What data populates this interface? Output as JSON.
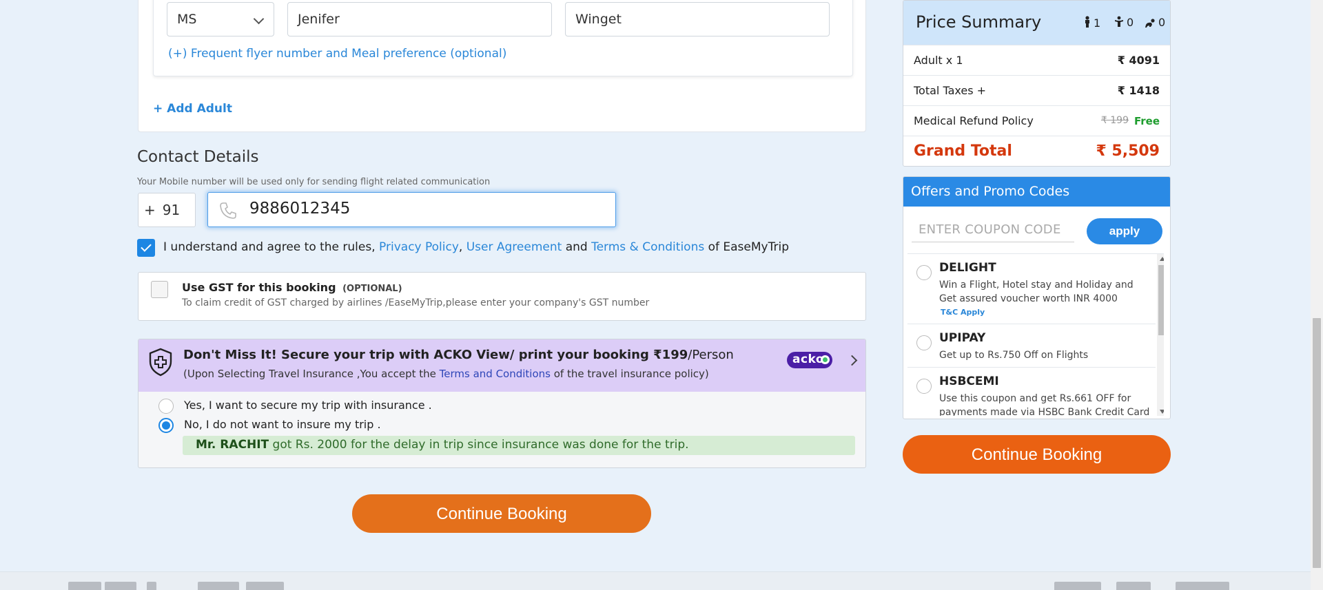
{
  "traveller": {
    "title_value": "MS",
    "first_name": "Jenifer",
    "last_name": "Winget",
    "ff_link": "(+) Frequent flyer number and Meal preference (optional)",
    "add_adult": "+ Add Adult"
  },
  "contact": {
    "title": "Contact Details",
    "subtitle": "Your Mobile number will be used only for sending flight related communication",
    "country_plus": "+",
    "country_code": "91",
    "mobile": "9886012345"
  },
  "agree": {
    "prefix": "I understand and agree to the rules,",
    "privacy": "Privacy Policy",
    "sep": ",",
    "user_agreement": "User Agreement",
    "and": "and",
    "terms": "Terms & Conditions",
    "suffix": "of EaseMyTrip"
  },
  "gst": {
    "title": "Use GST for this booking",
    "optional": "(OPTIONAL)",
    "subtitle": "To claim credit of GST charged by airlines /EaseMyTrip,please enter your company's GST number"
  },
  "insurance": {
    "title": "Don't Miss It! Secure your trip with ACKO View/ print your booking",
    "price": "₹199",
    "per": "/Person",
    "sub_prefix": "(Upon Selecting Travel Insurance ,You accept the",
    "sub_link": "Terms and Conditions",
    "sub_suffix": "of the travel insurance policy)",
    "brand": "acko",
    "option_yes": "Yes, I want to secure my trip with insurance .",
    "option_no": "No, I do not want to insure my trip .",
    "selected": "no",
    "testimonial_name": "Mr. RACHIT",
    "testimonial_text": "got Rs. 2000 for the delay in trip since insurance was done for the trip."
  },
  "continue_label": "Continue Booking",
  "price_summary": {
    "title": "Price Summary",
    "adults": "1",
    "children": "0",
    "infants": "0",
    "rows": [
      {
        "label": "Adult x 1",
        "amount": "₹ 4091"
      },
      {
        "label": "Total Taxes +",
        "amount": "₹ 1418"
      },
      {
        "label": "Medical Refund Policy",
        "strike": "₹ 199",
        "amount": "Free"
      }
    ],
    "grand_label": "Grand Total",
    "grand_amount": "₹ 5,509"
  },
  "offers": {
    "title": "Offers and Promo Codes",
    "placeholder": "ENTER COUPON CODE",
    "apply_label": "apply",
    "items": [
      {
        "code": "DELIGHT",
        "desc": "Win a Flight, Hotel stay and Holiday and Get assured voucher worth INR 4000",
        "tnc": "T&C Apply"
      },
      {
        "code": "UPIPAY",
        "desc": "Get up to Rs.750 Off on Flights"
      },
      {
        "code": "HSBCEMI",
        "desc": "Use this coupon and get Rs.661 OFF for payments made via HSBC Bank Credit Card"
      }
    ]
  },
  "colors": {
    "accent_blue": "#2a8ae5",
    "cta_orange": "#e4701b",
    "grand_total_red": "#d4380d",
    "insurance_bg": "#dccdf7"
  }
}
